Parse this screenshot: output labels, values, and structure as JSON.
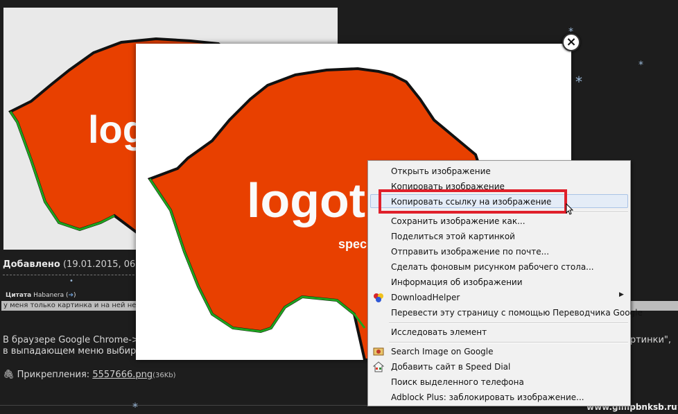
{
  "post": {
    "added_label": "Добавлено",
    "added_date": "(19.01.2015, 06",
    "quote_label": "Цитата",
    "quote_author": "Habanera (",
    "quote_text": "у меня только картинка и на ней нет",
    "body_line1": "В браузере Google Chrome->",
    "body_line1_end": "картинки\",",
    "body_line2": "в выпадающем меню выбира",
    "attachments_label": "Прикрепления:",
    "attachment_file": "5557666.png",
    "attachment_size": "(36Kb)"
  },
  "thumb": {
    "logo_text": "logo"
  },
  "lightbox": {
    "logo_text": "logot",
    "sub_text": "spec",
    "close_glyph": "×"
  },
  "context_menu": {
    "items": [
      {
        "label": "Открыть изображение"
      },
      {
        "label": "Копировать изображение"
      },
      {
        "label": "Копировать ссылку на изображение"
      },
      {
        "label": "Сохранить изображение как..."
      },
      {
        "label": "Поделиться этой картинкой"
      },
      {
        "label": "Отправить изображение по почте..."
      },
      {
        "label": "Сделать фоновым рисунком рабочего стола..."
      },
      {
        "label": "Информация об изображении"
      },
      {
        "label": "DownloadHelper"
      },
      {
        "label": "Перевести эту страницу с помощью Переводчика Google"
      },
      {
        "label": "Исследовать элемент"
      },
      {
        "label": "Search Image on Google"
      },
      {
        "label": "Добавить сайт в Speed Dial"
      },
      {
        "label": "Поиск выделенного телефона"
      },
      {
        "label": "Adblock Plus: заблокировать изображение..."
      }
    ],
    "submenu_arrow": "▶"
  },
  "watermark": "www.gimpbnksb.ru",
  "colors": {
    "logo_orange": "#e84000",
    "highlight_red": "#e0202b",
    "outline_green": "#1fa51f"
  }
}
